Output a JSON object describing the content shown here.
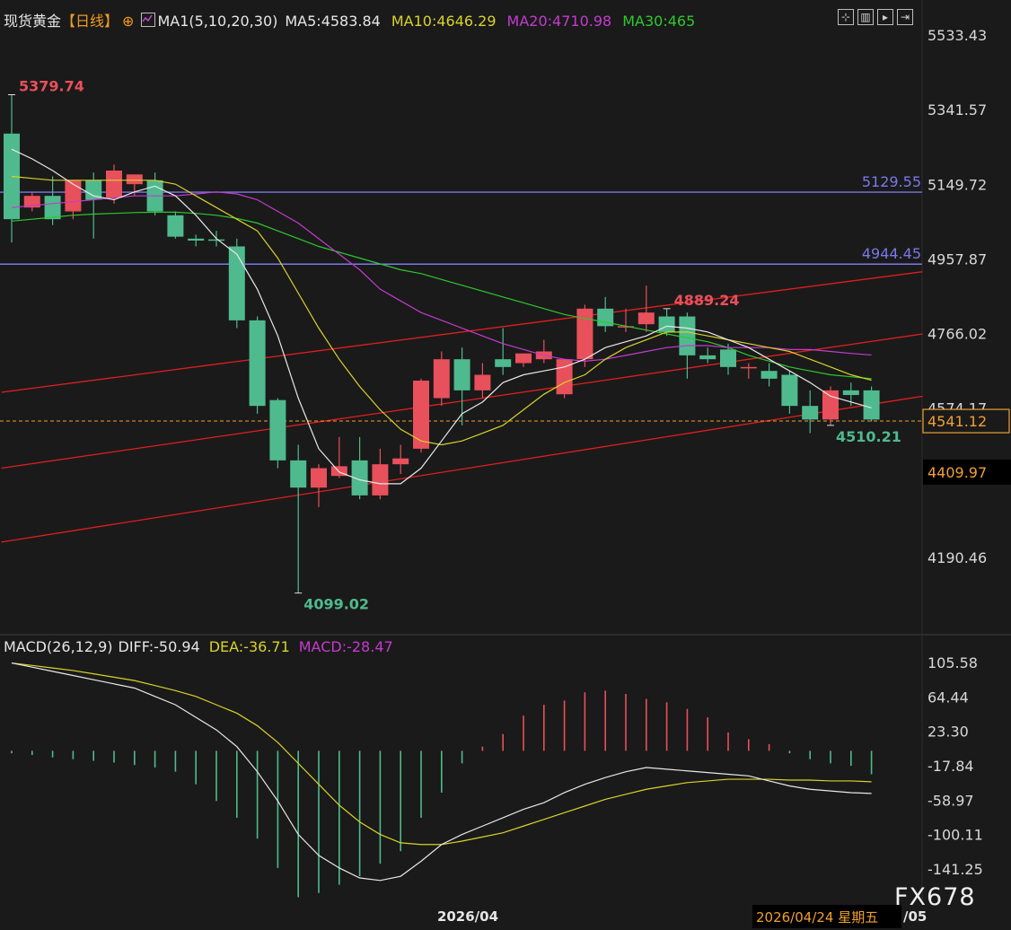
{
  "header": {
    "instrument": "现货黄金",
    "period": "【日线】",
    "ma_label": "MA1(5,10,20,30)",
    "ma5": "MA5:4583.84",
    "ma10": "MA10:4646.29",
    "ma20": "MA20:4710.98",
    "ma30": "MA30:465"
  },
  "macd_header": {
    "title": "MACD(26,12,9)",
    "diff": "DIFF:-50.94",
    "dea": "DEA:-36.71",
    "macd": "MACD:-28.47"
  },
  "colors": {
    "up": "#e8505b",
    "down": "#4fba8e",
    "ma5": "#e8e8e8",
    "ma10": "#d9d22a",
    "ma20": "#c43bd0",
    "ma30": "#2ec82e",
    "hline": "#7b78e8",
    "channel": "#e01e1e",
    "current": "#f0a030",
    "label_up": "#e8505b",
    "label_down": "#4fba8e"
  },
  "toolbar_icons": [
    "crosshair-icon",
    "window-icon",
    "play-icon",
    "exit-icon"
  ],
  "watermark": "FX678",
  "x_axis": {
    "month_label": "2026/04",
    "date_label": "2026/04/24 星期五",
    "date_tail": "/05"
  },
  "chart_data": {
    "type": "candlestick",
    "price_ticks": [
      5533.43,
      5341.57,
      5149.72,
      4957.87,
      4766.02,
      4574.17,
      4190.46
    ],
    "price_range": [
      4040,
      5600
    ],
    "macd_ticks": [
      105.58,
      64.44,
      23.3,
      -17.84,
      -58.97,
      -100.11,
      -141.25
    ],
    "macd_range": [
      -170,
      110
    ],
    "reference_lines": [
      {
        "value": 5129.55,
        "label": "5129.55"
      },
      {
        "value": 4944.45,
        "label": "4944.45"
      }
    ],
    "current_price": {
      "value": 4541.12,
      "label": "4541.12"
    },
    "crosshair_price": {
      "value": 4409.97,
      "label": "4409.97"
    },
    "annotations": [
      {
        "text": "5379.74",
        "type": "high",
        "candle": 0
      },
      {
        "text": "4889.24",
        "type": "high",
        "candle": 32
      },
      {
        "text": "4099.02",
        "type": "low",
        "candle": 14
      },
      {
        "text": "4510.21",
        "type": "low",
        "candle": 40
      }
    ],
    "candles": [
      {
        "o": 5280,
        "h": 5380,
        "c": 5060,
        "l": 5000
      },
      {
        "o": 5090,
        "h": 5130,
        "c": 5120,
        "l": 5080
      },
      {
        "o": 5120,
        "h": 5170,
        "c": 5060,
        "l": 5045
      },
      {
        "o": 5080,
        "h": 5160,
        "c": 5160,
        "l": 5060
      },
      {
        "o": 5160,
        "h": 5180,
        "c": 5110,
        "l": 5010
      },
      {
        "o": 5115,
        "h": 5200,
        "c": 5185,
        "l": 5100
      },
      {
        "o": 5150,
        "h": 5175,
        "c": 5175,
        "l": 5120
      },
      {
        "o": 5160,
        "h": 5180,
        "c": 5080,
        "l": 5070
      },
      {
        "o": 5070,
        "h": 5080,
        "c": 5015,
        "l": 5010
      },
      {
        "o": 5010,
        "h": 5020,
        "c": 5005,
        "l": 4990
      },
      {
        "o": 5008,
        "h": 5030,
        "c": 5005,
        "l": 4990
      },
      {
        "o": 4990,
        "h": 5010,
        "c": 4800,
        "l": 4780
      },
      {
        "o": 4800,
        "h": 4810,
        "c": 4580,
        "l": 4560
      },
      {
        "o": 4595,
        "h": 4600,
        "c": 4440,
        "l": 4420
      },
      {
        "o": 4440,
        "h": 4480,
        "c": 4370,
        "l": 4099
      },
      {
        "o": 4370,
        "h": 4430,
        "c": 4420,
        "l": 4320
      },
      {
        "o": 4400,
        "h": 4500,
        "c": 4425,
        "l": 4395
      },
      {
        "o": 4440,
        "h": 4500,
        "c": 4350,
        "l": 4340
      },
      {
        "o": 4350,
        "h": 4470,
        "c": 4430,
        "l": 4340
      },
      {
        "o": 4430,
        "h": 4480,
        "c": 4445,
        "l": 4405
      },
      {
        "o": 4470,
        "h": 4650,
        "c": 4645,
        "l": 4460
      },
      {
        "o": 4600,
        "h": 4720,
        "c": 4700,
        "l": 4580
      },
      {
        "o": 4700,
        "h": 4730,
        "c": 4620,
        "l": 4530
      },
      {
        "o": 4620,
        "h": 4690,
        "c": 4660,
        "l": 4600
      },
      {
        "o": 4700,
        "h": 4780,
        "c": 4680,
        "l": 4660
      },
      {
        "o": 4690,
        "h": 4715,
        "c": 4715,
        "l": 4680
      },
      {
        "o": 4700,
        "h": 4750,
        "c": 4720,
        "l": 4690
      },
      {
        "o": 4610,
        "h": 4700,
        "c": 4700,
        "l": 4600
      },
      {
        "o": 4700,
        "h": 4840,
        "c": 4830,
        "l": 4680
      },
      {
        "o": 4830,
        "h": 4860,
        "c": 4785,
        "l": 4770
      },
      {
        "o": 4785,
        "h": 4830,
        "c": 4785,
        "l": 4770
      },
      {
        "o": 4790,
        "h": 4889,
        "c": 4820,
        "l": 4770
      },
      {
        "o": 4810,
        "h": 4830,
        "c": 4770,
        "l": 4760
      },
      {
        "o": 4810,
        "h": 4820,
        "c": 4710,
        "l": 4650
      },
      {
        "o": 4710,
        "h": 4730,
        "c": 4700,
        "l": 4690
      },
      {
        "o": 4725,
        "h": 4740,
        "c": 4680,
        "l": 4660
      },
      {
        "o": 4680,
        "h": 4690,
        "c": 4680,
        "l": 4650
      },
      {
        "o": 4670,
        "h": 4690,
        "c": 4650,
        "l": 4630
      },
      {
        "o": 4660,
        "h": 4670,
        "c": 4580,
        "l": 4560
      },
      {
        "o": 4580,
        "h": 4620,
        "c": 4545,
        "l": 4510
      },
      {
        "o": 4545,
        "h": 4630,
        "c": 4620,
        "l": 4530
      },
      {
        "o": 4620,
        "h": 4640,
        "c": 4608,
        "l": 4580
      },
      {
        "o": 4620,
        "h": 4630,
        "c": 4545,
        "l": 4540
      }
    ],
    "ma5": [
      5240,
      5215,
      5185,
      5150,
      5120,
      5110,
      5130,
      5145,
      5120,
      5070,
      5010,
      4970,
      4880,
      4760,
      4600,
      4470,
      4410,
      4390,
      4380,
      4380,
      4420,
      4490,
      4560,
      4590,
      4640,
      4660,
      4670,
      4680,
      4700,
      4730,
      4745,
      4760,
      4785,
      4780,
      4770,
      4750,
      4730,
      4700,
      4670,
      4640,
      4605,
      4590,
      4575
    ],
    "ma10": [
      5170,
      5165,
      5160,
      5160,
      5160,
      5160,
      5160,
      5160,
      5150,
      5120,
      5090,
      5060,
      5030,
      4960,
      4870,
      4780,
      4700,
      4630,
      4570,
      4520,
      4490,
      4480,
      4490,
      4510,
      4530,
      4570,
      4610,
      4640,
      4660,
      4700,
      4730,
      4750,
      4770,
      4770,
      4760,
      4750,
      4740,
      4730,
      4720,
      4700,
      4680,
      4660,
      4646
    ],
    "ma20": [
      5090,
      5095,
      5100,
      5105,
      5110,
      5115,
      5120,
      5120,
      5120,
      5125,
      5130,
      5125,
      5110,
      5080,
      5050,
      5010,
      4970,
      4930,
      4880,
      4850,
      4820,
      4800,
      4780,
      4760,
      4740,
      4725,
      4710,
      4700,
      4695,
      4700,
      4710,
      4720,
      4730,
      4735,
      4735,
      4730,
      4730,
      4730,
      4725,
      4725,
      4720,
      4715,
      4711
    ],
    "ma30": [
      5055,
      5060,
      5065,
      5070,
      5073,
      5075,
      5077,
      5078,
      5078,
      5075,
      5070,
      5062,
      5050,
      5030,
      5010,
      4990,
      4975,
      4960,
      4945,
      4930,
      4920,
      4905,
      4890,
      4875,
      4860,
      4845,
      4830,
      4815,
      4805,
      4795,
      4785,
      4775,
      4765,
      4755,
      4745,
      4730,
      4710,
      4695,
      4680,
      4670,
      4660,
      4655,
      4650
    ],
    "channel_lines": [
      {
        "from": [
          -0.5,
          4615
        ],
        "to": [
          44.5,
          4925
        ]
      },
      {
        "from": [
          -0.5,
          4420
        ],
        "to": [
          44.5,
          4765
        ]
      },
      {
        "from": [
          -0.5,
          4230
        ],
        "to": [
          44.5,
          4605
        ]
      }
    ],
    "macd": {
      "diff": [
        105,
        100,
        95,
        90,
        85,
        80,
        75,
        65,
        55,
        40,
        25,
        5,
        -25,
        -60,
        -100,
        -125,
        -140,
        -152,
        -155,
        -150,
        -132,
        -112,
        -100,
        -90,
        -80,
        -70,
        -62,
        -50,
        -40,
        -32,
        -25,
        -20,
        -22,
        -24,
        -26,
        -28,
        -30,
        -36,
        -42,
        -46,
        -48,
        -50,
        -51
      ],
      "dea": [
        105,
        102,
        99,
        96,
        92,
        88,
        84,
        78,
        72,
        65,
        55,
        45,
        30,
        10,
        -15,
        -40,
        -65,
        -85,
        -100,
        -110,
        -112,
        -112,
        -108,
        -103,
        -98,
        -90,
        -82,
        -74,
        -66,
        -58,
        -52,
        -46,
        -42,
        -38,
        -36,
        -34,
        -34,
        -34,
        -35,
        -35,
        -36,
        -36,
        -37
      ],
      "hist": [
        -3,
        -5,
        -8,
        -10,
        -12,
        -14,
        -17,
        -20,
        -25,
        -40,
        -60,
        -80,
        -105,
        -140,
        -175,
        -170,
        -160,
        -150,
        -135,
        -120,
        -80,
        -50,
        -15,
        5,
        20,
        42,
        55,
        60,
        70,
        72,
        68,
        62,
        58,
        50,
        40,
        22,
        14,
        8,
        -3,
        -10,
        -15,
        -18,
        -28
      ]
    }
  }
}
